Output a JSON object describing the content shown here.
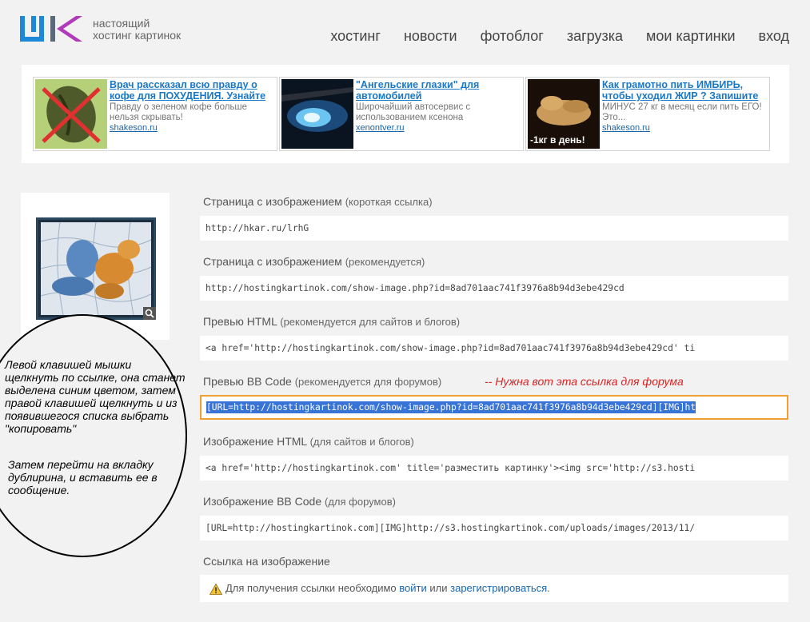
{
  "header": {
    "logo_line1": "настоящий",
    "logo_line2": "хостинг картинок",
    "nav": [
      "хостинг",
      "новости",
      "фотоблог",
      "загрузка",
      "мои картинки",
      "вход"
    ]
  },
  "ads": [
    {
      "title": "Врач рассказал всю правду о кофе для ПОХУДЕНИЯ. Узнайте",
      "desc": "Правду о зеленом кофе больше нельзя скрывать!",
      "domain": "shakeson.ru"
    },
    {
      "title": "\"Ангельские глазки\" для автомобилей",
      "desc": "Широчайший автосервис с использованием ксенона",
      "domain": "xenontver.ru"
    },
    {
      "title": "Как грамотно пить ИМБИРЬ, чтобы уходил ЖИР ? Запишите",
      "desc": "МИНУС 27 кг в месяц если пить ЕГО! Это...",
      "domain": "shakeson.ru",
      "badge": "-1кг в день!"
    }
  ],
  "annotation": {
    "note1": "Левой клавишей мышки щелкнуть по ссылке, она станет выделена синим цветом, затем правой клавишей щелкнуть и из появившегося списка выбрать \"копировать\"",
    "note2": "Затем перейти на вкладку дублирина, и вставить ее в сообщение.",
    "arrow_note": "-- Нужна вот эта ссылка для форума"
  },
  "links": [
    {
      "label": "Страница с изображением",
      "hint": "(короткая ссылка)",
      "value": "http://hkar.ru/lrhG"
    },
    {
      "label": "Страница с изображением",
      "hint": "(рекомендуется)",
      "value": "http://hostingkartinok.com/show-image.php?id=8ad701aac741f3976a8b94d3ebe429cd"
    },
    {
      "label": "Превью HTML",
      "hint": "(рекомендуется для сайтов и блогов)",
      "value": "<a href='http://hostingkartinok.com/show-image.php?id=8ad701aac741f3976a8b94d3ebe429cd' ti"
    },
    {
      "label": "Превью BB Code",
      "hint": "(рекомендуется для форумов)",
      "value": "[URL=http://hostingkartinok.com/show-image.php?id=8ad701aac741f3976a8b94d3ebe429cd][IMG]ht"
    },
    {
      "label": "Изображение HTML",
      "hint": "(для сайтов и блогов)",
      "value": "<a href='http://hostingkartinok.com' title='разместить картинку'><img src='http://s3.hosti"
    },
    {
      "label": "Изображение BB Code",
      "hint": "(для форумов)",
      "value": "[URL=http://hostingkartinok.com][IMG]http://s3.hostingkartinok.com/uploads/images/2013/11/"
    }
  ],
  "direct_link": {
    "label": "Ссылка на изображение",
    "notice_prefix": "Для получения ссылки необходимо",
    "login": "войти",
    "or": "или",
    "register": "зарегистрироваться",
    "suffix": "."
  },
  "colors": {
    "accent": "#1a78c6",
    "logo_blue": "#1e88d8",
    "logo_purple": "#b03ab8",
    "selection": "#3873d6",
    "focus_border": "#f0a030",
    "note_red": "#d22222"
  }
}
